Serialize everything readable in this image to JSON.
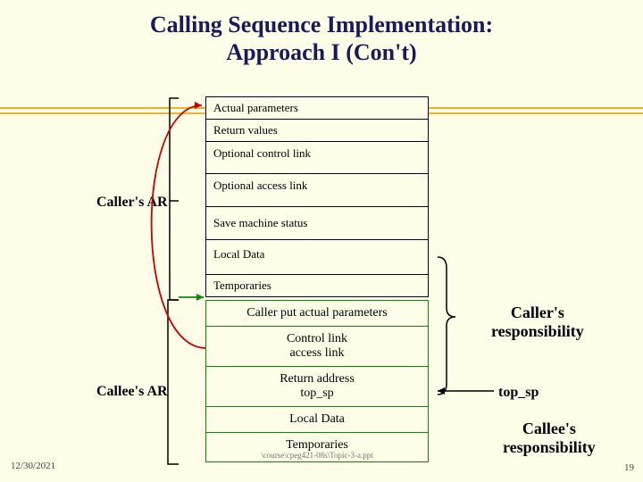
{
  "title_line1": "Calling Sequence Implementation:",
  "title_line2": "Approach I (Con't)",
  "caller_ar_label": "Caller's AR",
  "callee_ar_label": "Callee's AR",
  "caller_cells": [
    "Actual parameters",
    "Return values",
    "Optional control link",
    "Optional access link",
    "Save machine status",
    "Local Data",
    "Temporaries"
  ],
  "callee_cells": {
    "c0": "Caller put actual parameters",
    "c1_l1": "Control link",
    "c1_l2": "access link",
    "c2_l1": "Return address",
    "c2_l2": "top_sp",
    "c3": "Local Data",
    "c4": "Temporaries"
  },
  "footer_path": "\\course\\cpeg421-08s\\Topic-3-a.ppt",
  "resp_caller_l1": "Caller's",
  "resp_caller_l2": "responsibility",
  "top_sp_label": "top_sp",
  "resp_callee_l1": "Callee's",
  "resp_callee_l2": "responsibility",
  "date": "12/30/2021",
  "slide_number": "19"
}
